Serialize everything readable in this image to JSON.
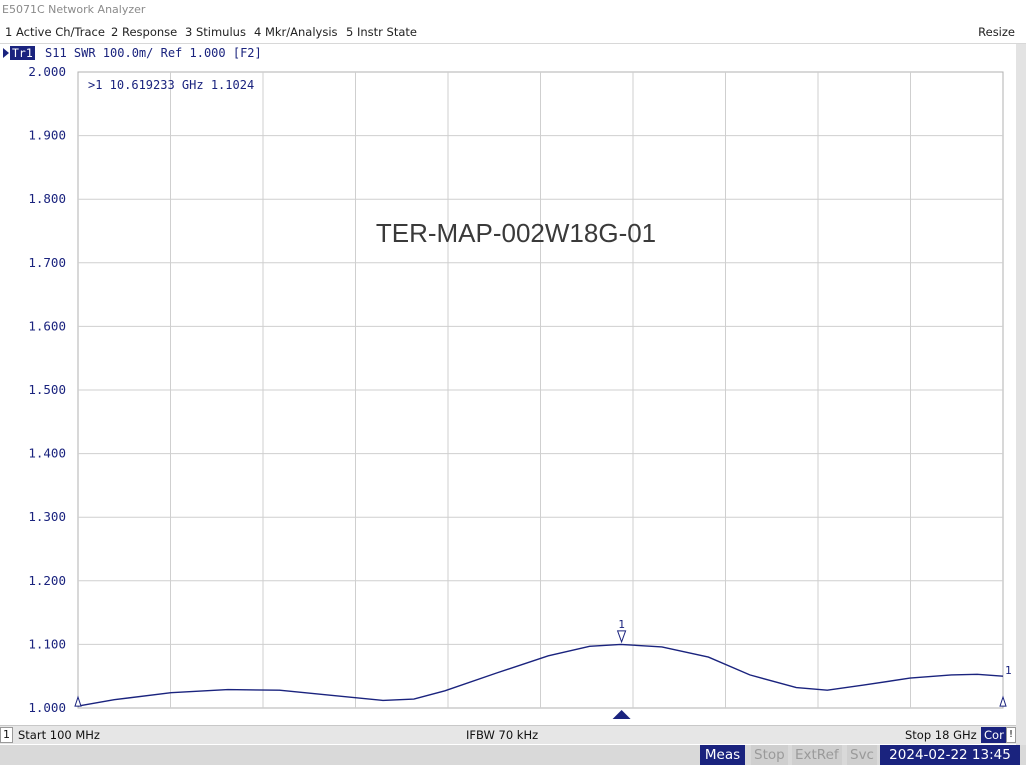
{
  "window": {
    "title": "E5071C Network Analyzer"
  },
  "menu": {
    "items": [
      "1 Active Ch/Trace",
      "2 Response",
      "3 Stimulus",
      "4 Mkr/Analysis",
      "5 Instr State"
    ],
    "resize": "Resize"
  },
  "trace": {
    "label": "Tr1",
    "info": "S11  SWR 100.0m/  Ref 1.000  [F2]",
    "color": "#1a237e"
  },
  "marker": {
    "readout": ">1  10.619233 GHz  1.1024",
    "label": "1",
    "freq_ghz": 10.619233,
    "value": 1.1024
  },
  "annotation": "TER-MAP-002W18G-01",
  "status": {
    "channel": "1",
    "start": "Start 100 MHz",
    "ifbw": "IFBW 70 kHz",
    "stop": "Stop 18 GHz",
    "cor": "Cor",
    "warn": "!"
  },
  "bottom": {
    "meas": "Meas",
    "stop": "Stop",
    "extref": "ExtRef",
    "svc": "Svc",
    "datetime": "2024-02-22 13:45"
  },
  "chart_data": {
    "type": "line",
    "title": "",
    "xlabel": "",
    "ylabel": "",
    "x_unit": "GHz",
    "xlim": [
      0.1,
      18
    ],
    "ylim": [
      1.0,
      2.0
    ],
    "y_ticks": [
      "2.000",
      "1.900",
      "1.800",
      "1.700",
      "1.600",
      "1.500",
      "1.400",
      "1.300",
      "1.200",
      "1.100",
      "1.000"
    ],
    "grid": true,
    "series": [
      {
        "color": "#1a237e",
        "x": [
          0.1,
          0.8,
          1.9,
          3.0,
          4.0,
          5.0,
          6.0,
          6.6,
          7.2,
          8.2,
          9.2,
          10.0,
          10.6,
          11.4,
          12.3,
          13.1,
          14.0,
          14.6,
          15.3,
          16.2,
          17.0,
          17.5,
          18.0
        ],
        "y": [
          1.003,
          1.013,
          1.024,
          1.029,
          1.028,
          1.02,
          1.012,
          1.014,
          1.027,
          1.055,
          1.082,
          1.097,
          1.1,
          1.096,
          1.08,
          1.052,
          1.032,
          1.028,
          1.036,
          1.047,
          1.052,
          1.053,
          1.05
        ]
      }
    ],
    "marker": {
      "label": "1",
      "x": 10.619233,
      "y": 1.1024
    }
  }
}
